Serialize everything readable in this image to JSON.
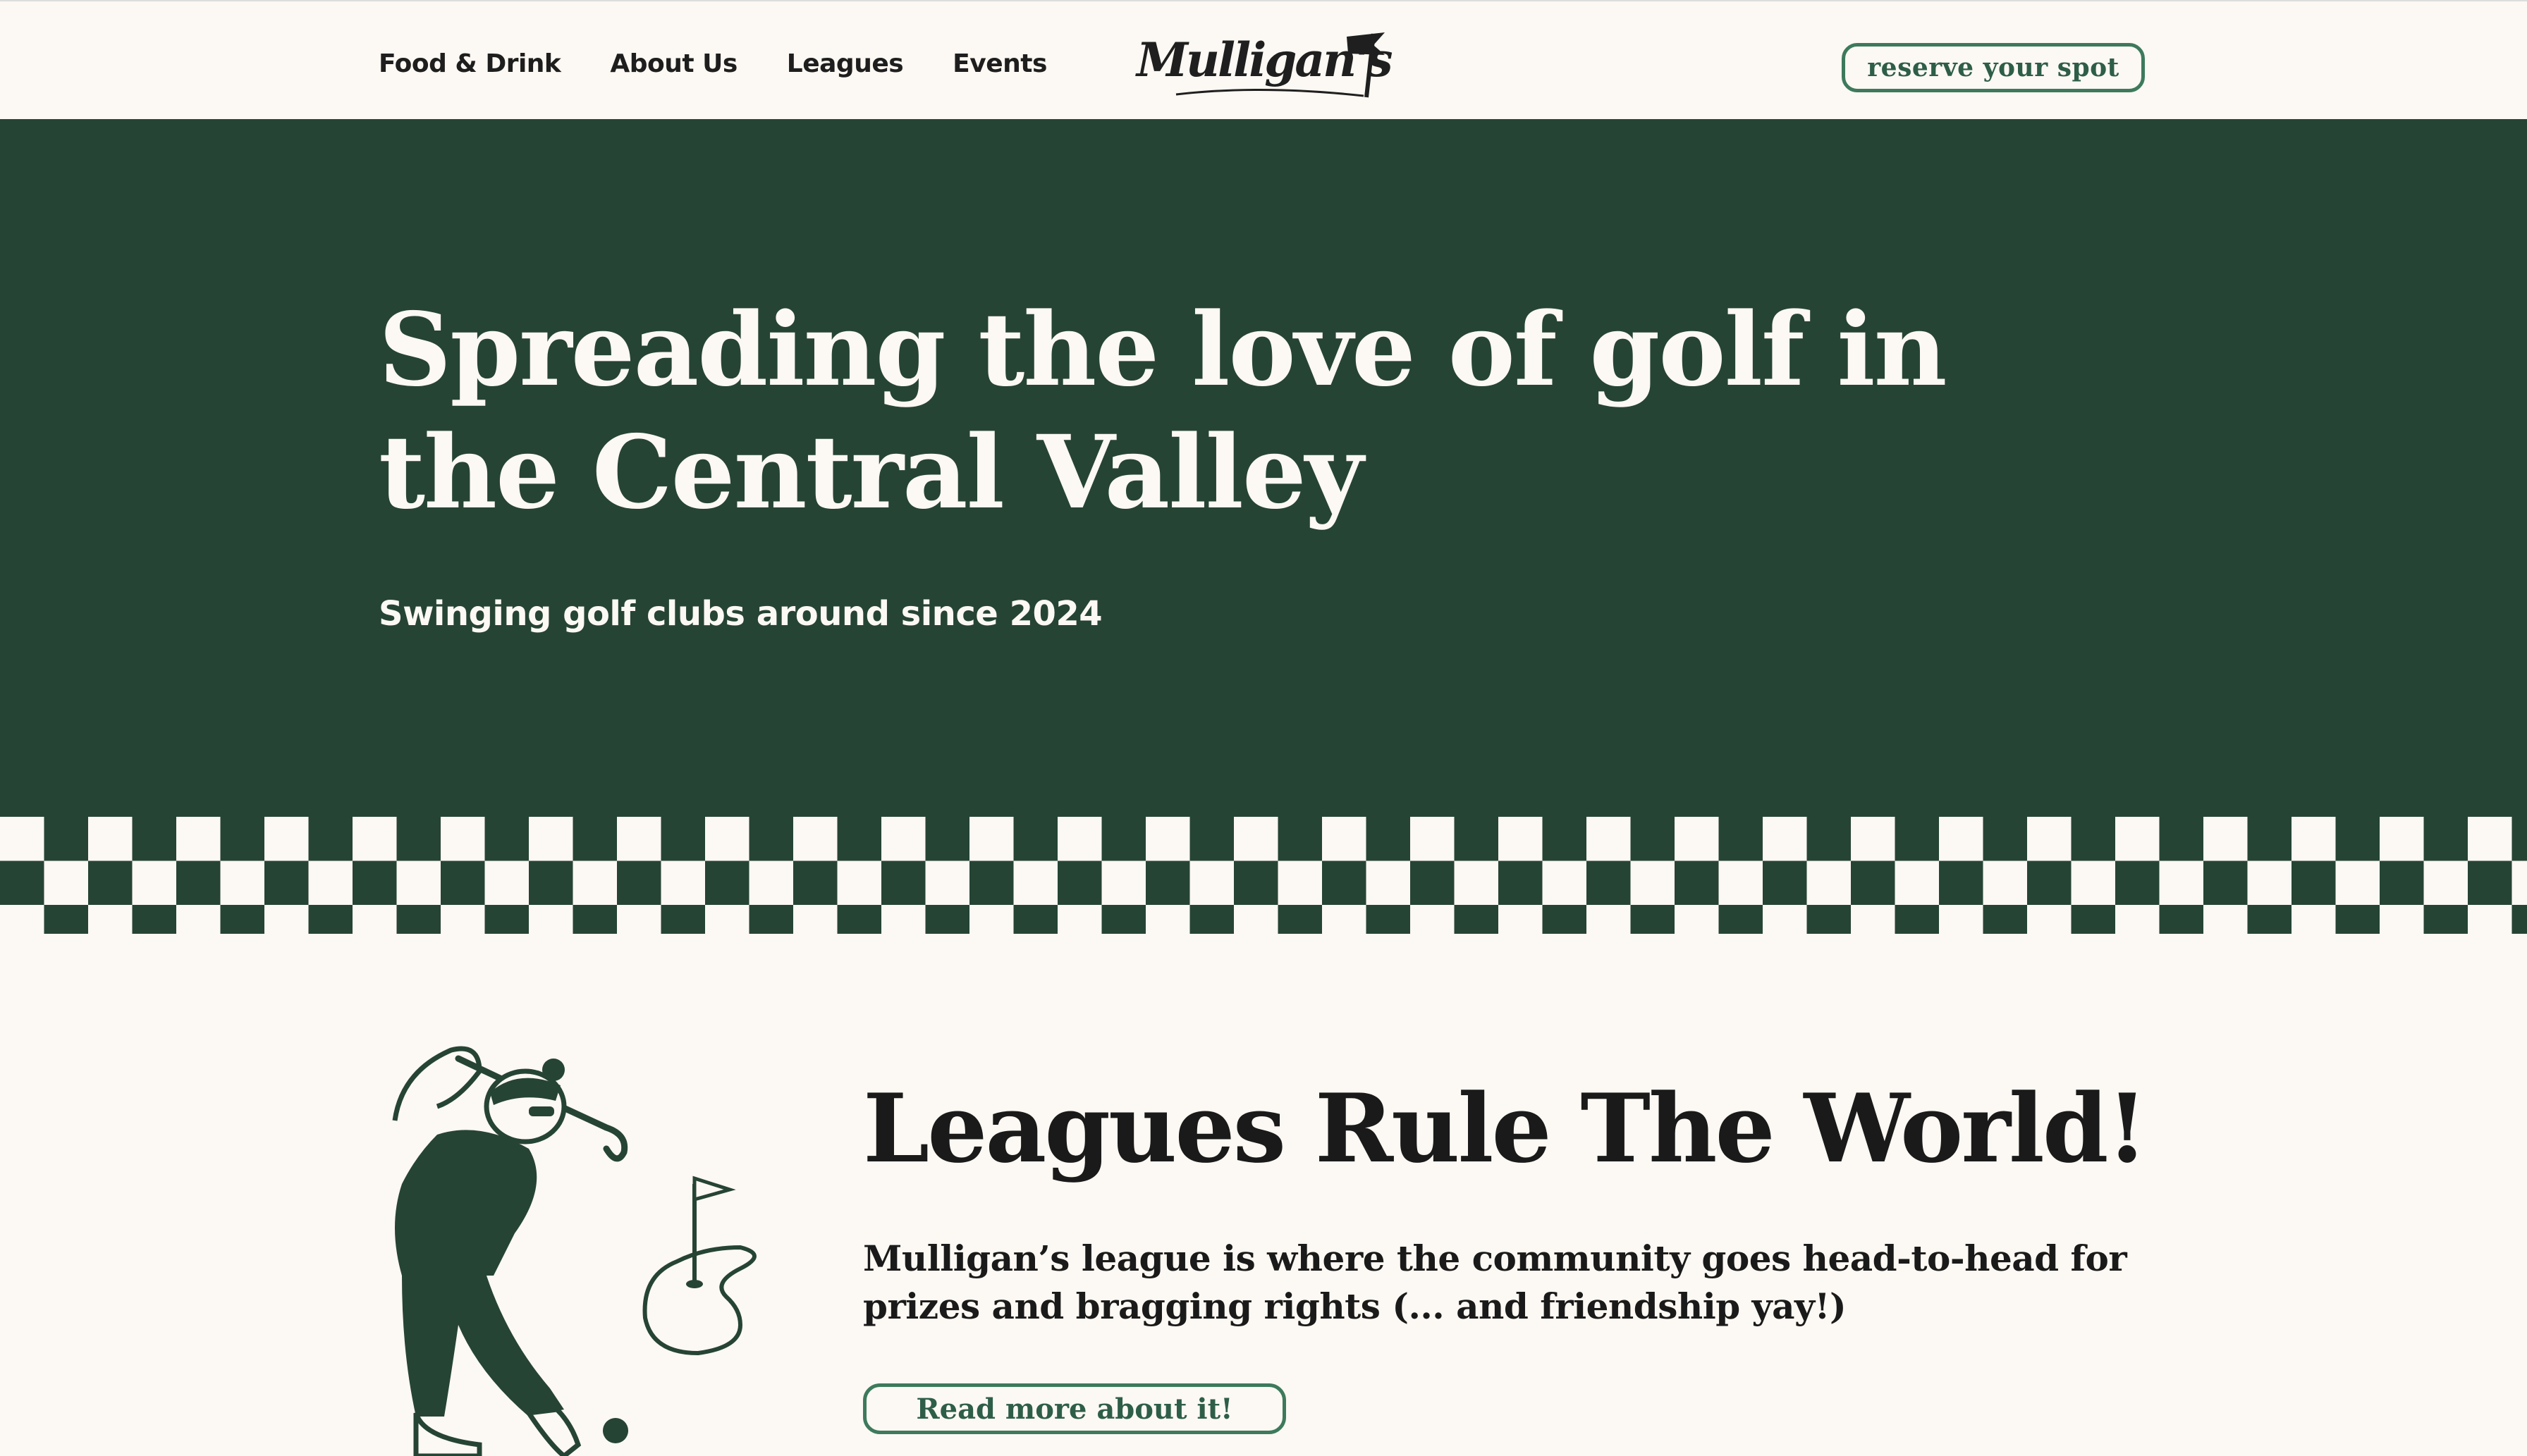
{
  "nav": {
    "links": [
      "Food & Drink",
      "About Us",
      "Leagues",
      "Events"
    ],
    "logo_text": "Mulligan's",
    "reserve_label": "reserve your spot"
  },
  "hero": {
    "title": "Spreading the love of golf in the Central Valley",
    "subtitle": "Swinging golf clubs around since 2024"
  },
  "league": {
    "title": "Leagues Rule The World!",
    "body": "Mulligan’s league is where the community goes head-to-head for prizes and bragging rights (... and friendship yay!)",
    "button_label": "Read more about it!"
  },
  "colors": {
    "background": "#fcf8f3",
    "hero_green": "#264434",
    "accent_green": "#3d7a5c",
    "text_dark": "#1a1a1a"
  },
  "icons": {
    "logo": "golf-flag-logo",
    "illustration": "golfer-swing-illustration",
    "flag": "golf-flag-icon",
    "ball": "golf-ball-icon"
  }
}
